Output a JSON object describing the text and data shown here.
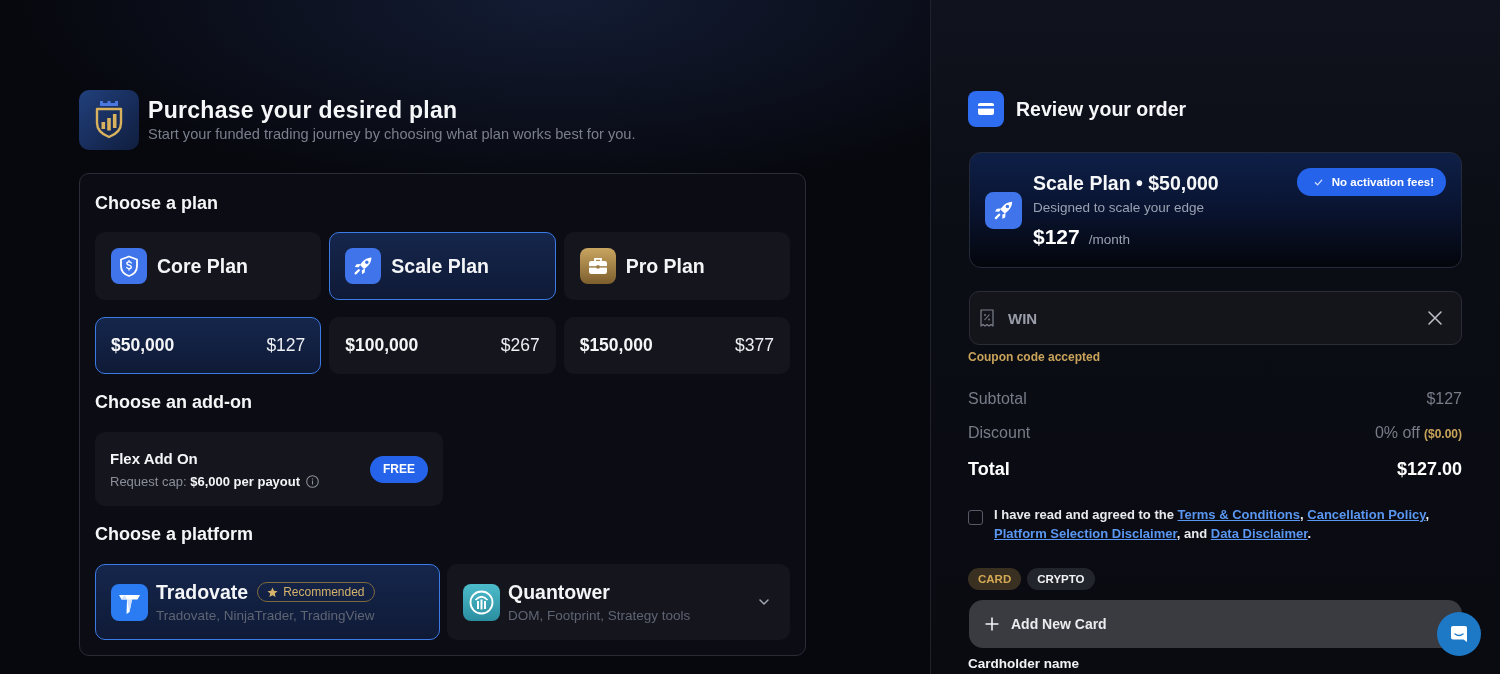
{
  "header": {
    "title": "Purchase your desired plan",
    "subtitle": "Start your funded trading journey by choosing what plan works best for you."
  },
  "plan_section": {
    "heading": "Choose a plan",
    "plans": [
      {
        "label": "Core Plan",
        "selected": false
      },
      {
        "label": "Scale Plan",
        "selected": true
      },
      {
        "label": "Pro Plan",
        "selected": false
      }
    ],
    "sizes": [
      {
        "amount": "$50,000",
        "price": "$127",
        "selected": true
      },
      {
        "amount": "$100,000",
        "price": "$267",
        "selected": false
      },
      {
        "amount": "$150,000",
        "price": "$377",
        "selected": false
      }
    ]
  },
  "addon_section": {
    "heading": "Choose an add-on",
    "addons": [
      {
        "title": "Flex Add On",
        "description": "Request cap: **$6,000 per payout**",
        "badge": "FREE"
      }
    ]
  },
  "platform_section": {
    "heading": "Choose a platform",
    "platforms": [
      {
        "kind": "option",
        "name": "Tradovate",
        "badge": "Recommended",
        "features": "Tradovate, NinjaTrader, TradingView",
        "selected": true
      },
      {
        "kind": "dropdown",
        "name": "Quantower",
        "features": "DOM, Footprint, Strategy tools",
        "selected": false
      }
    ]
  },
  "review": {
    "title": "Review your order",
    "order": {
      "title": "Scale Plan • $50,000",
      "subtitle": "Designed to scale your edge",
      "price": "$127",
      "period": "/month",
      "badge": "No activation fees!"
    },
    "coupon": {
      "value": "WIN",
      "status": "Coupon code accepted"
    },
    "summary": [
      {
        "kind": "line",
        "label": "Subtotal",
        "value": "$127"
      },
      {
        "kind": "line",
        "label": "Discount",
        "value": "0% off",
        "note": "($0.00)"
      },
      {
        "kind": "total",
        "label": "Total",
        "value": "$127.00"
      }
    ],
    "agreement": {
      "checked": false,
      "parts": [
        {
          "kind": "text",
          "text": "I have read and agreed to the "
        },
        {
          "kind": "link",
          "text": "Terms & Conditions"
        },
        {
          "kind": "text",
          "text": ", "
        },
        {
          "kind": "link",
          "text": "Cancellation Policy"
        },
        {
          "kind": "text",
          "text": ", "
        },
        {
          "kind": "link",
          "text": "Platform Selection Disclaimer"
        },
        {
          "kind": "text",
          "text": ", and "
        },
        {
          "kind": "link",
          "text": "Data Disclaimer"
        },
        {
          "kind": "text",
          "text": "."
        }
      ]
    },
    "payment_methods": [
      {
        "label": "CARD",
        "selected": true
      },
      {
        "label": "CRYPTO",
        "selected": false
      }
    ],
    "add_card_button": "Add New Card",
    "cardholder_label": "Cardholder name"
  }
}
